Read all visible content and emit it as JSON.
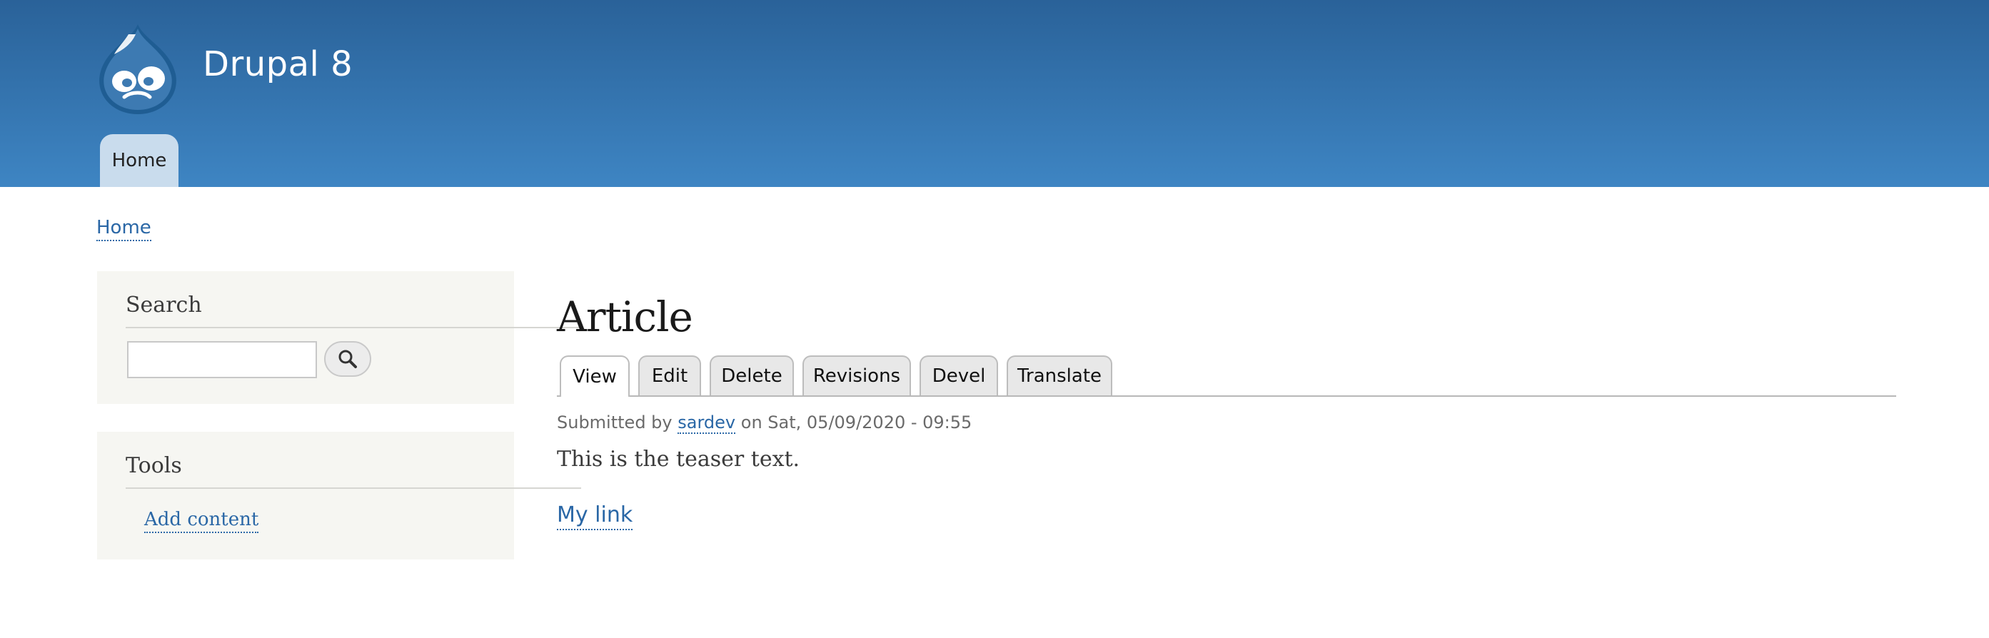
{
  "header": {
    "site_name": "Drupal 8",
    "nav": {
      "home": "Home"
    },
    "colors": {
      "gradient_top": "#2a6299",
      "gradient_bottom": "#3e85c3",
      "nav_tab_bg": "#c9dced"
    }
  },
  "breadcrumb": {
    "home": "Home"
  },
  "sidebar": {
    "search": {
      "title": "Search",
      "input_value": "",
      "button_icon": "search-icon"
    },
    "tools": {
      "title": "Tools",
      "links": [
        "Add content"
      ]
    }
  },
  "main": {
    "title": "Article",
    "tabs": [
      "View",
      "Edit",
      "Delete",
      "Revisions",
      "Devel",
      "Translate"
    ],
    "active_tab": "View",
    "meta": {
      "prefix": "Submitted by",
      "author": "sardev",
      "suffix": "on Sat, 05/09/2020 - 09:55"
    },
    "teaser": "This is the teaser text.",
    "link": "My link"
  },
  "colors": {
    "link": "#2a67a6",
    "block_bg": "#f6f6f2"
  }
}
